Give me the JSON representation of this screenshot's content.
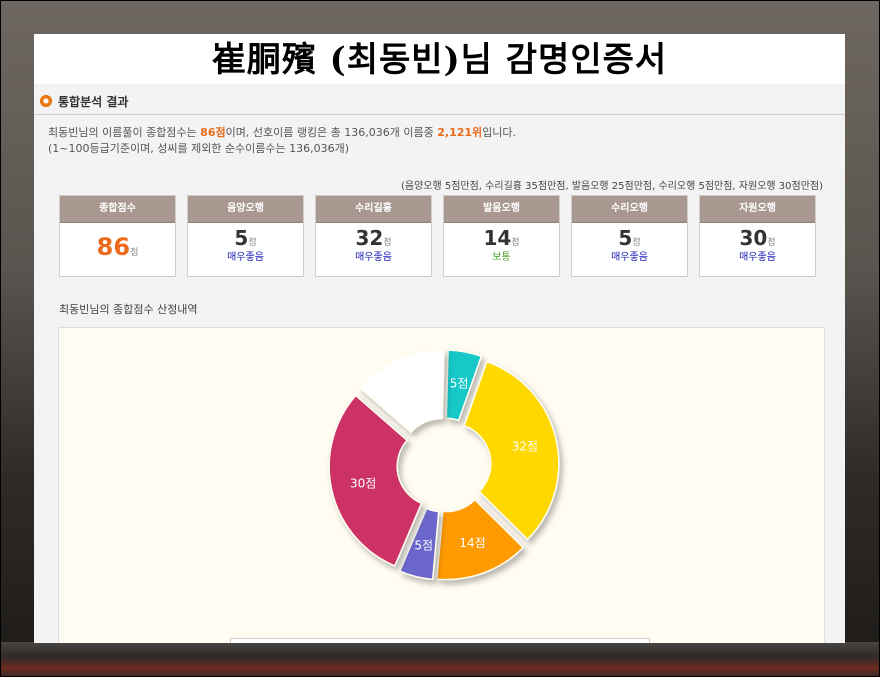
{
  "title": "崔胴殯 (최동빈)님 감명인증서",
  "section": {
    "label": "통합분석 결과"
  },
  "summary": {
    "line1_a": "최동빈님의 이름풀이 종합점수는 ",
    "score_text": "86점",
    "line1_b": "이며, 선호이름 랭킹은 총 136,036개 이름중 ",
    "rank_text": "2,121위",
    "line1_c": "입니다.",
    "line2": "(1~100등급기준이며, 성씨를 제외한 순수이름수는 136,036개)"
  },
  "criteria": "(음양오행 5점만점, 수리길흉 35점만점, 발음오행 25점만점, 수리오행 5점만점, 자원오행 30점만점)",
  "cards": [
    {
      "label": "종합점수",
      "value": "86",
      "unit": "점",
      "grade": ""
    },
    {
      "label": "음양오행",
      "value": "5",
      "unit": "점",
      "grade": "매우좋음"
    },
    {
      "label": "수리길흉",
      "value": "32",
      "unit": "점",
      "grade": "매우좋음"
    },
    {
      "label": "발음오행",
      "value": "14",
      "unit": "점",
      "grade": "보통"
    },
    {
      "label": "수리오행",
      "value": "5",
      "unit": "점",
      "grade": "매우좋음"
    },
    {
      "label": "자원오행",
      "value": "30",
      "unit": "점",
      "grade": "매우좋음"
    }
  ],
  "breakdown_title": "최동빈님의 종합점수 산정내역",
  "chart_data": {
    "type": "pie",
    "total": 100,
    "slices": [
      {
        "value": 5,
        "label": "5점",
        "color": "#16c8c8"
      },
      {
        "value": 32,
        "label": "32점",
        "color": "#ffd800"
      },
      {
        "value": 14,
        "label": "14점",
        "color": "#ff9a00"
      },
      {
        "value": 5,
        "label": "5점",
        "color": "#6b66cc"
      },
      {
        "value": 30,
        "label": "30점",
        "color": "#cc3366"
      },
      {
        "value": 14,
        "label": "",
        "color": "#ffffff"
      }
    ]
  }
}
